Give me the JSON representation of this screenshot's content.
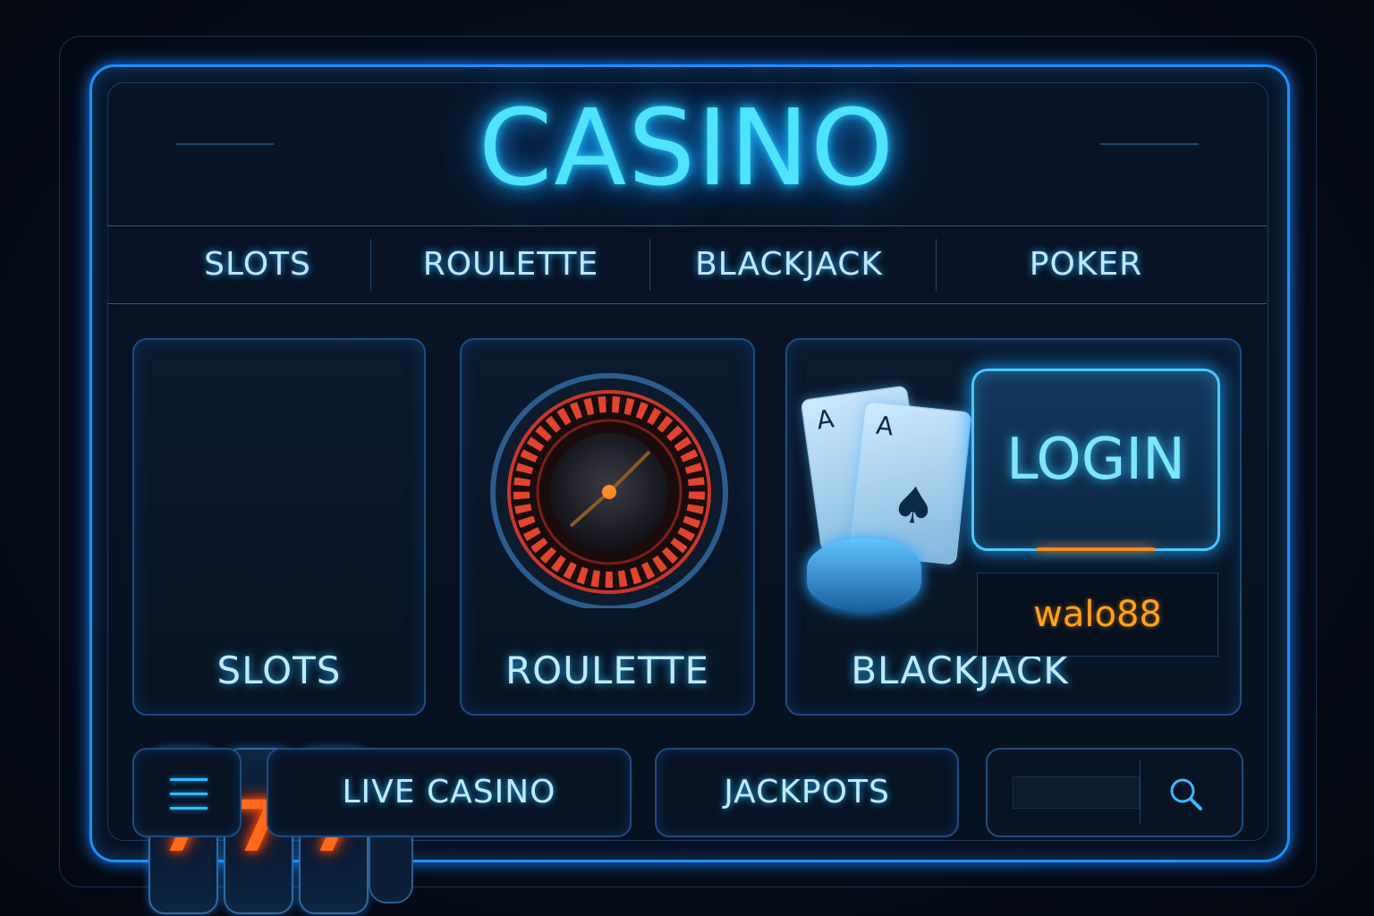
{
  "app": {
    "title": "CASINO"
  },
  "nav": {
    "items": [
      "SLOTS",
      "ROULETTE",
      "BLACKJACK",
      "POKER"
    ]
  },
  "cards": [
    {
      "label": "SLOTS",
      "icon": "slot-machine-icon"
    },
    {
      "label": "ROULETTE",
      "icon": "roulette-wheel-icon"
    },
    {
      "label": "BLACKJACK",
      "icon": "playing-cards-icon"
    }
  ],
  "slots": {
    "reel_symbol": "7"
  },
  "playing_cards": {
    "rank": "A"
  },
  "login": {
    "label": "LOGIN"
  },
  "user": {
    "name": "walo88"
  },
  "bottom": {
    "live_casino": "LIVE CASINO",
    "jackpots": "JACKPOTS",
    "menu_icon": "hamburger-menu-icon",
    "search_icon": "search-icon"
  },
  "colors": {
    "accent": "#1e90ff",
    "title_glow": "#4fe3ff",
    "username": "#ffa21c",
    "reel_seven": "#ff6a1a"
  }
}
